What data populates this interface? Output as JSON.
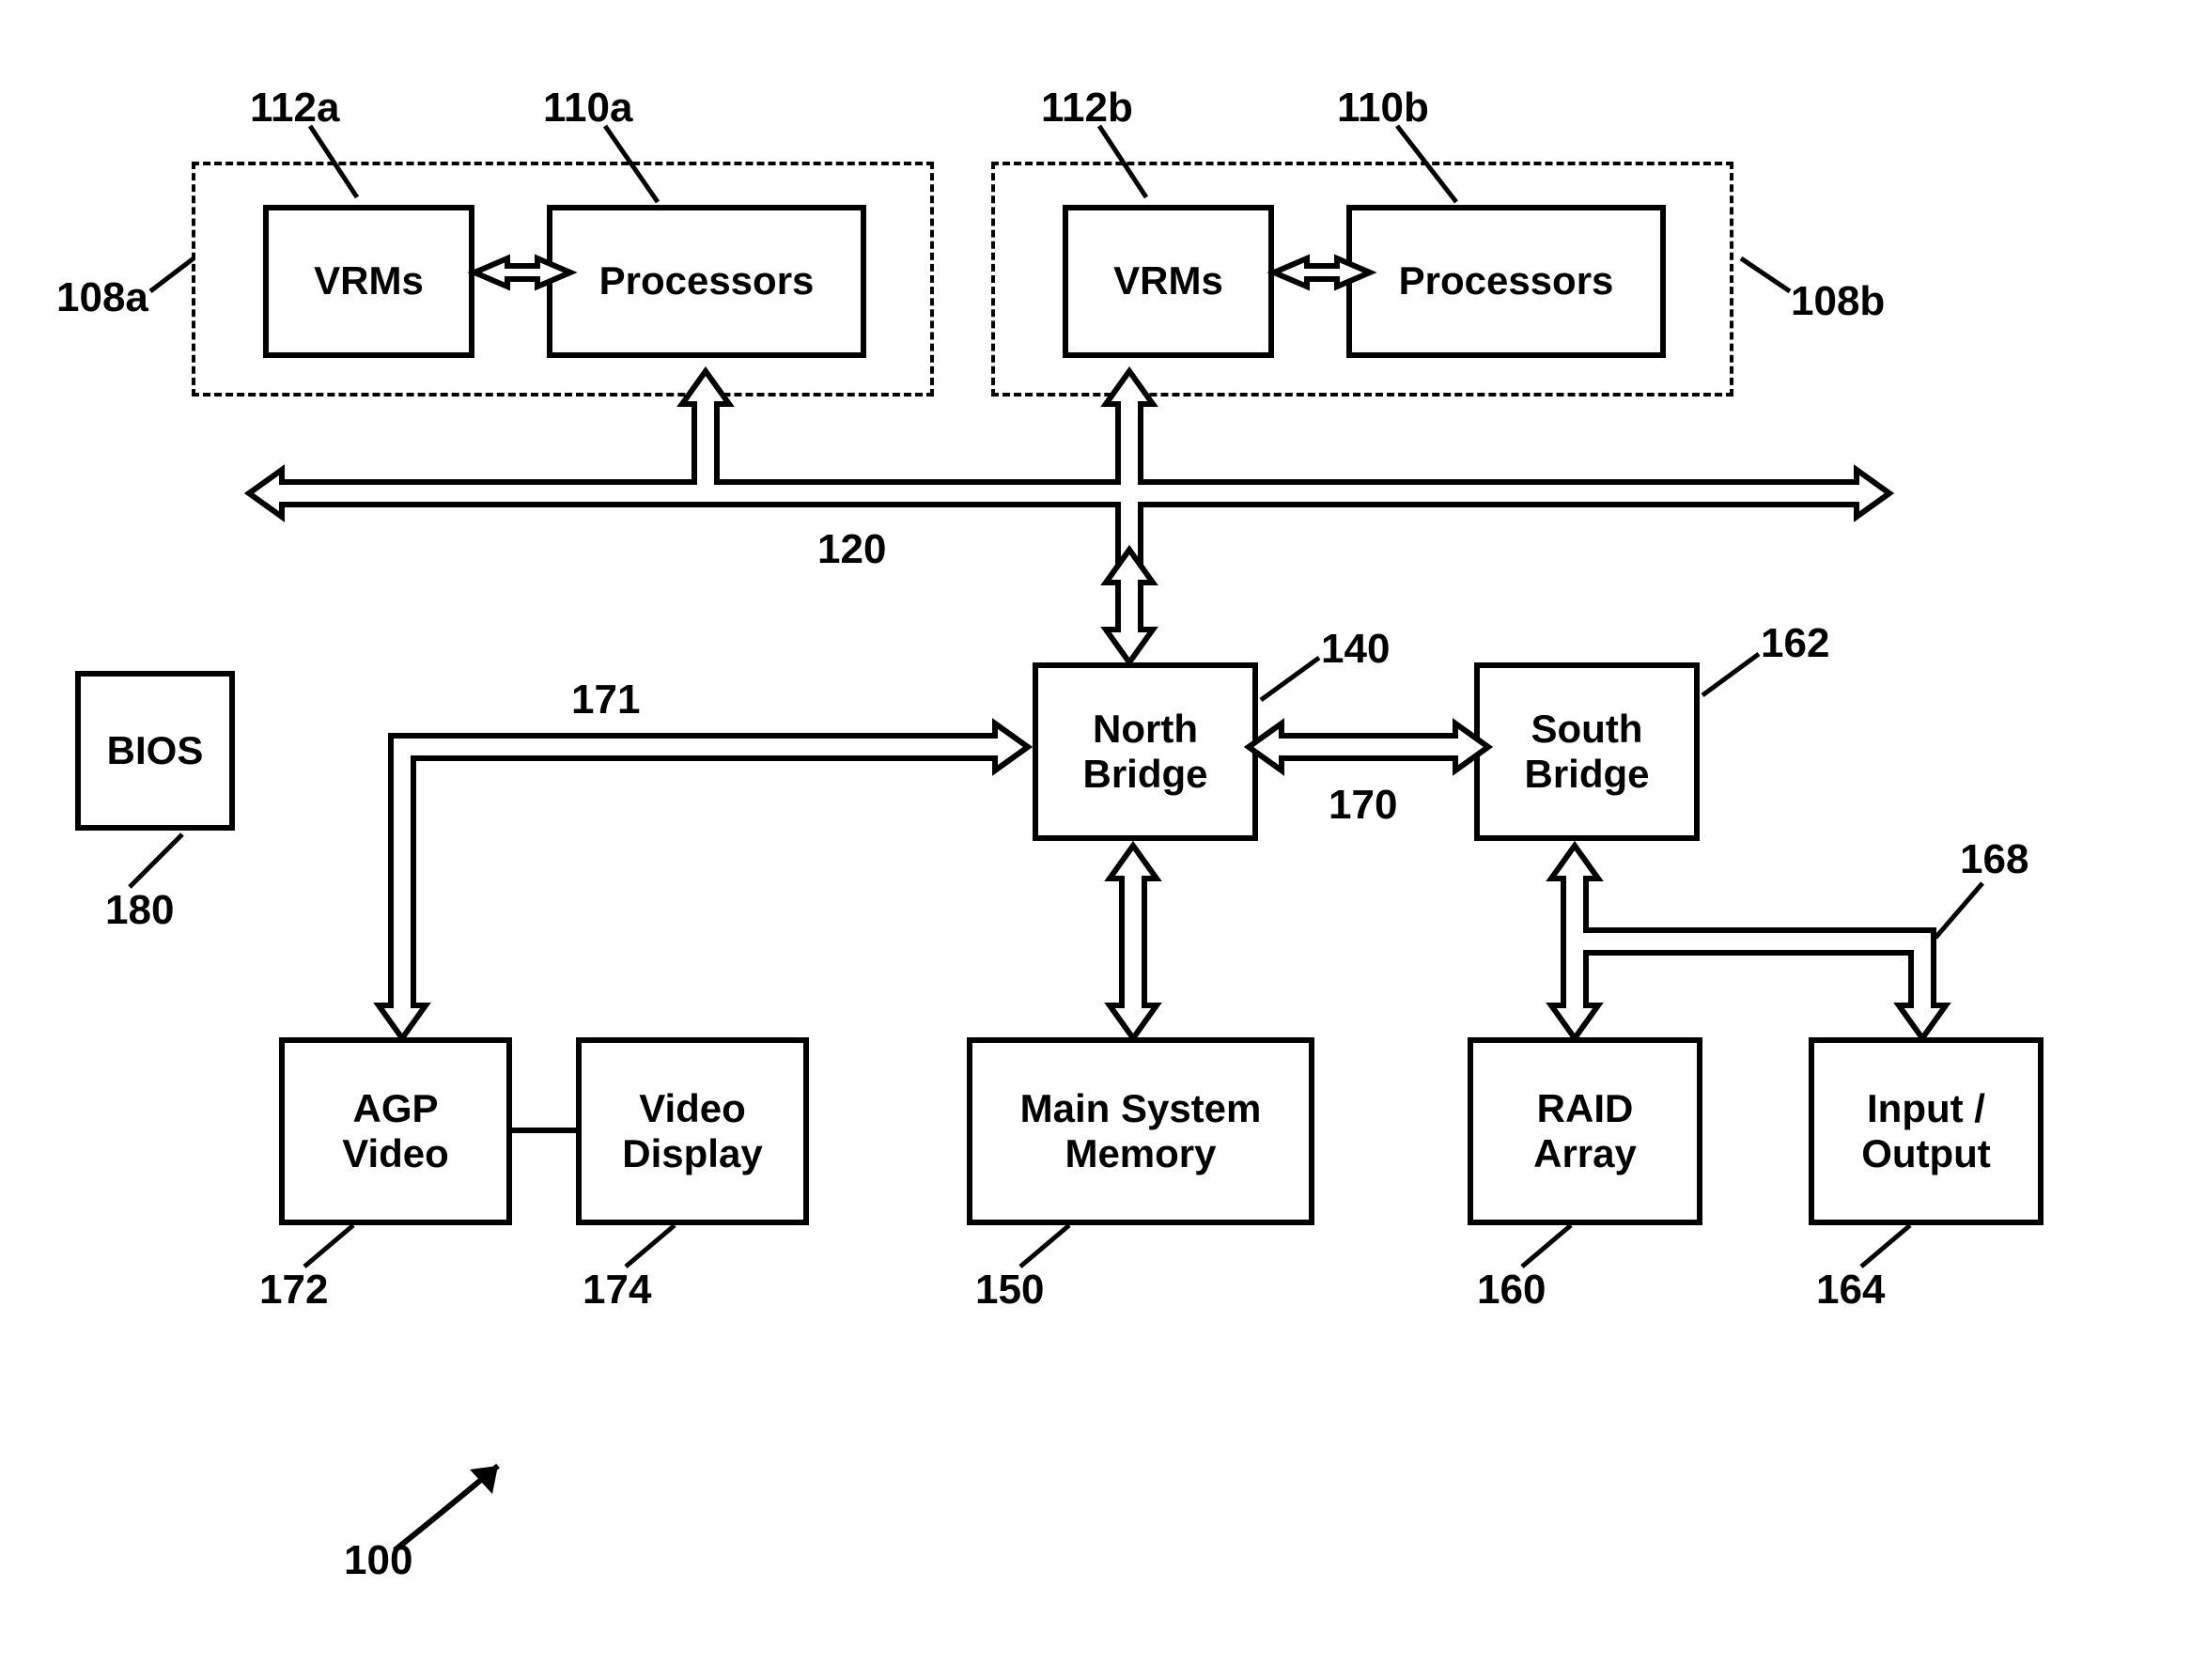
{
  "groups": {
    "a": {
      "vrm": "VRMs",
      "proc": "Processors"
    },
    "b": {
      "vrm": "VRMs",
      "proc": "Processors"
    }
  },
  "blocks": {
    "bios": "BIOS",
    "north": "North\nBridge",
    "south": "South\nBridge",
    "agp": "AGP\nVideo",
    "vdisp": "Video\nDisplay",
    "mem": "Main System\nMemory",
    "raid": "RAID\nArray",
    "io": "Input /\nOutput"
  },
  "refs": {
    "r112a": "112a",
    "r110a": "110a",
    "r112b": "112b",
    "r110b": "110b",
    "r108a": "108a",
    "r108b": "108b",
    "r120": "120",
    "r171": "171",
    "r140": "140",
    "r162": "162",
    "r170": "170",
    "r168": "168",
    "r180": "180",
    "r172": "172",
    "r174": "174",
    "r150": "150",
    "r160": "160",
    "r164": "164",
    "r100": "100"
  }
}
